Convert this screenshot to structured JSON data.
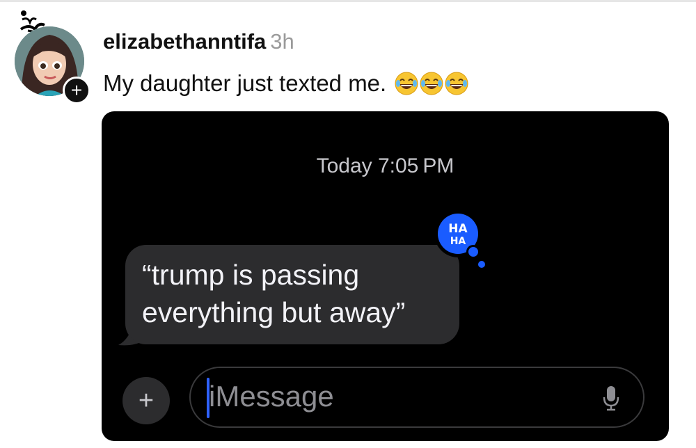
{
  "post": {
    "username": "elizabethanntifa",
    "time_ago": "3h",
    "caption": "My daughter just texted me.",
    "caption_emoji": [
      "rolling-on-floor-laughing-emoji",
      "rolling-on-floor-laughing-emoji",
      "rolling-on-floor-laughing-emoji"
    ],
    "follow_button": "+"
  },
  "messages": {
    "timestamp": "Today 7:05 PM",
    "incoming_message": "“trump is passing everything but away”",
    "reaction": {
      "icon": "haha-reaction-icon",
      "text_line1": "HA",
      "text_line2": "HA",
      "color": "#1a5cff"
    },
    "plus_button": "+",
    "input_placeholder": "iMessage"
  }
}
